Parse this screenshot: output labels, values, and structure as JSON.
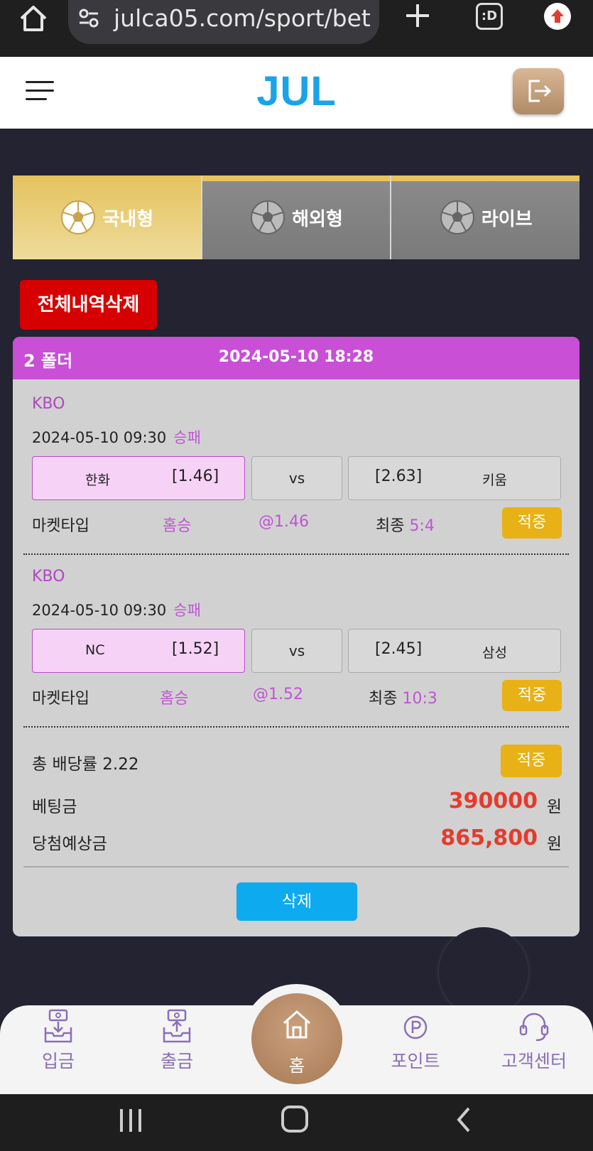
{
  "browser": {
    "url": "julca05.com/sport/bet",
    "tab_count": ":D"
  },
  "header": {
    "logo": "JUL"
  },
  "tabs": [
    {
      "label": "국내형",
      "active": true
    },
    {
      "label": "해외형",
      "active": false
    },
    {
      "label": "라이브",
      "active": false
    }
  ],
  "delete_all_label": "전체내역삭제",
  "bet": {
    "folder": "2 폴더",
    "datetime": "2024-05-10 18:28",
    "games": [
      {
        "league": "KBO",
        "date": "2024-05-10 09:30",
        "type": "승패",
        "home_team": "한화",
        "home_odd": "[1.46]",
        "vs": "vs",
        "away_odd": "[2.63]",
        "away_team": "키움",
        "market_label": "마켓타입",
        "pick": "홈승",
        "pick_odd": "@1.46",
        "final_label": "최종",
        "score": "5:4",
        "result": "적중"
      },
      {
        "league": "KBO",
        "date": "2024-05-10 09:30",
        "type": "승패",
        "home_team": "NC",
        "home_odd": "[1.52]",
        "vs": "vs",
        "away_odd": "[2.45]",
        "away_team": "삼성",
        "market_label": "마켓타입",
        "pick": "홈승",
        "pick_odd": "@1.52",
        "final_label": "최종",
        "score": "10:3",
        "result": "적중"
      }
    ],
    "total_odds_label": "총 배당률 2.22",
    "total_result": "적중",
    "stake_label": "베팅금",
    "stake": "390000",
    "payout_label": "당첨예상금",
    "payout": "865,800",
    "currency": "원",
    "delete_label": "삭제"
  },
  "bottom_nav": {
    "deposit": "입금",
    "withdraw": "출금",
    "home": "홈",
    "point": "포인트",
    "support": "고객센터"
  },
  "colors": {
    "accent": "#c84fd6",
    "gold": "#e4c25e",
    "danger": "#d60000",
    "primary_blue": "#0daaf0",
    "win": "#e8b115"
  }
}
